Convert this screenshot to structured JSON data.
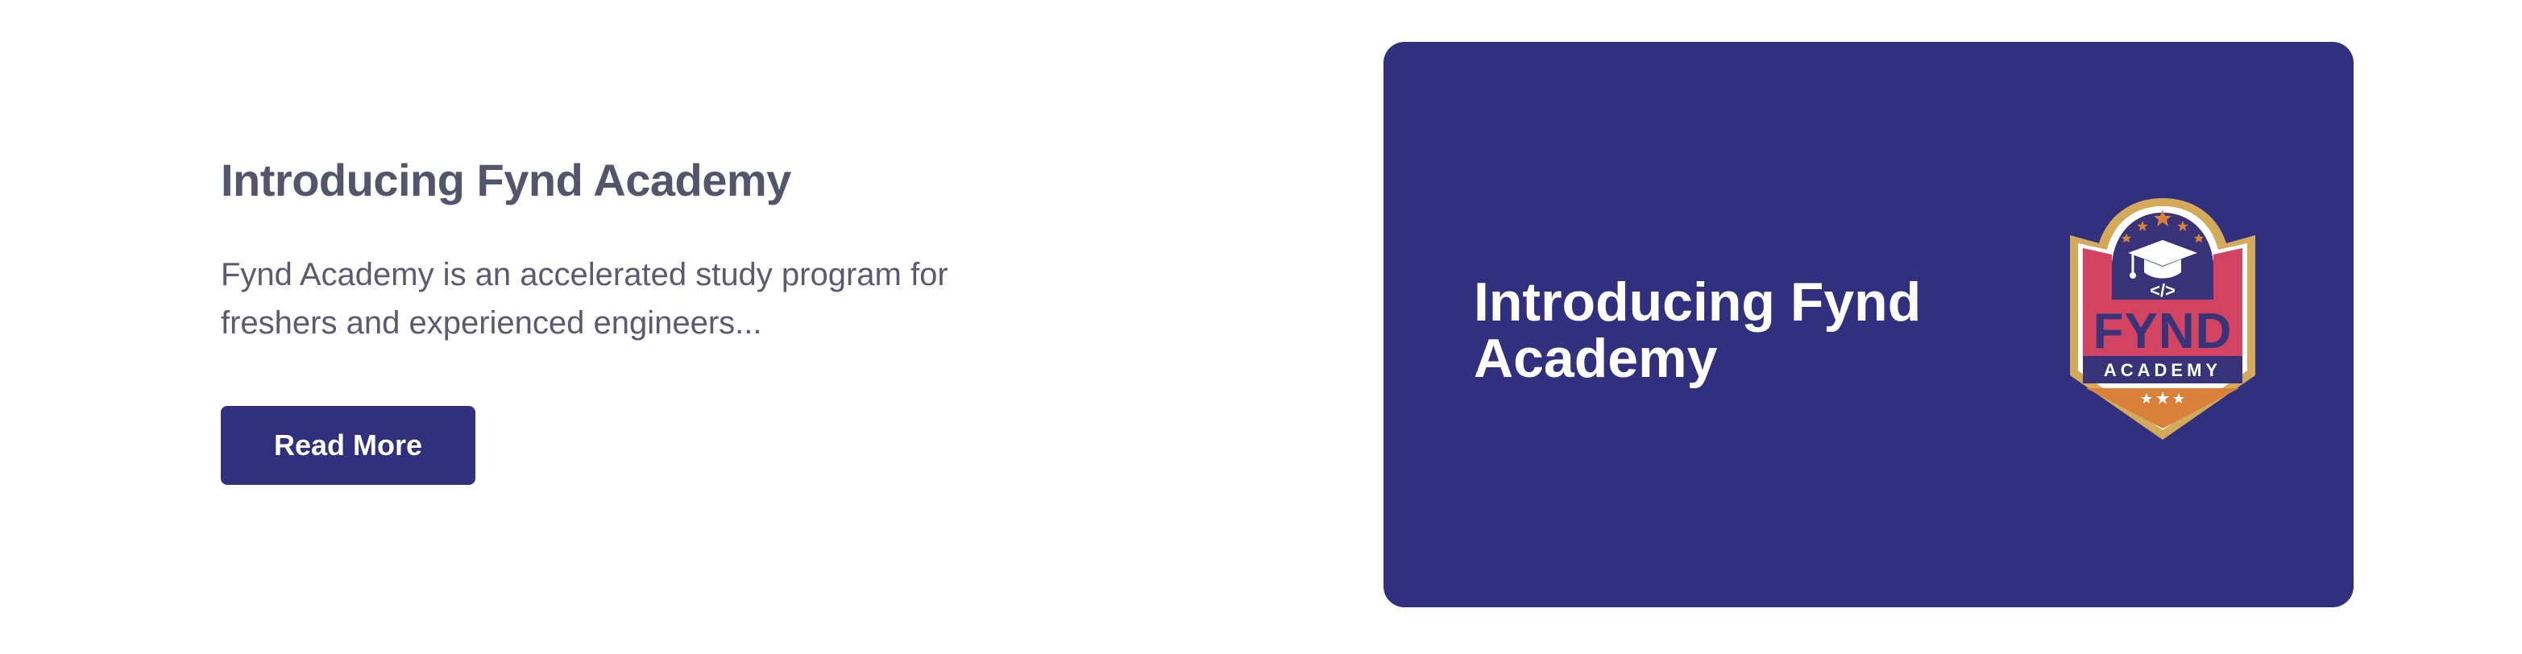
{
  "article": {
    "title": "Introducing Fynd Academy",
    "description": "Fynd Academy is an accelerated study program for freshers and experienced engineers...",
    "read_more_label": "Read More"
  },
  "card": {
    "title": "Introducing Fynd Academy",
    "badge": {
      "wordmark": "FYND",
      "subtitle": "ACADEMY",
      "code_glyph": "</>",
      "icons": [
        "graduation-cap-icon",
        "code-icon",
        "star-icon"
      ]
    }
  },
  "colors": {
    "primary": "#30307F",
    "title_text": "#54546A",
    "body_text": "#5A5A70",
    "badge_red": "#D24461",
    "badge_gold": "#D4A95A",
    "badge_orange": "#D9803A"
  }
}
